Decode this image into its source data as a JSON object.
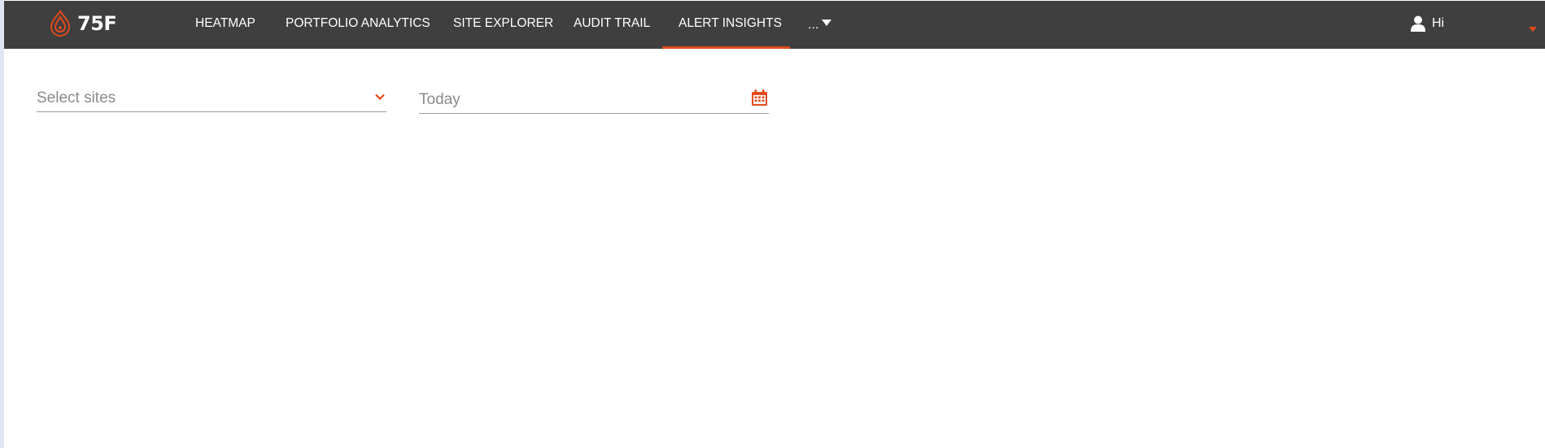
{
  "nav": {
    "brand": "75F",
    "items": [
      {
        "label": "HEATMAP"
      },
      {
        "label": "PORTFOLIO ANALYTICS"
      },
      {
        "label": "SITE EXPLORER"
      },
      {
        "label": "AUDIT TRAIL"
      },
      {
        "label": "ALERT INSIGHTS",
        "active": true
      }
    ],
    "more_label": "...",
    "user_greeting": "Hi"
  },
  "filters": {
    "sites": {
      "placeholder": "Select sites",
      "icon": "chevron-down-icon"
    },
    "date": {
      "value": "Today",
      "icon": "calendar-icon"
    }
  },
  "colors": {
    "navbar": "#3f3f3f",
    "accent": "#e24a1c"
  }
}
